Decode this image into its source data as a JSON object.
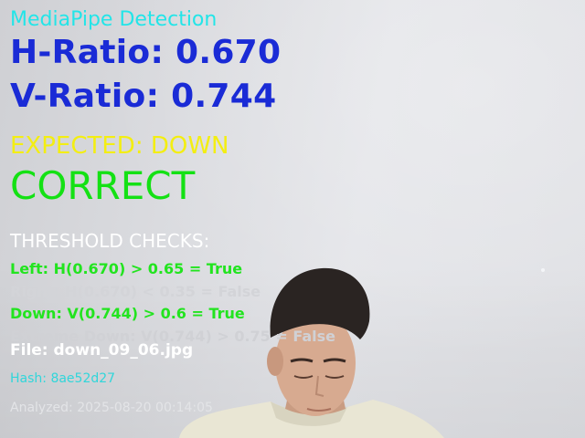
{
  "overlay": {
    "title": "MediaPipe Detection",
    "h_ratio": "H-Ratio: 0.670",
    "v_ratio": "V-Ratio: 0.744",
    "expected": "EXPECTED: DOWN",
    "verdict": "CORRECT",
    "threshold_header": "THRESHOLD CHECKS:",
    "checks": [
      "Left: H(0.670) > 0.65 = True",
      "Right: H(0.670) < 0.35 = False",
      "Down: V(0.744) > 0.6 = True",
      "Extreme Down: V(0.744) > 0.75 = False"
    ],
    "file": "File: down_09_06.jpg",
    "hash": "Hash: 8ae52d27",
    "analyzed": "Analyzed: 2025-08-20 00:14:05"
  },
  "colors": {
    "title": "#22e5e8",
    "ratio": "#1a2bd6",
    "expected": "#f3ee12",
    "correct": "#14e114",
    "true_check": "#22e41f",
    "false_check": "#d3d4d8",
    "hash": "#30d6da"
  }
}
